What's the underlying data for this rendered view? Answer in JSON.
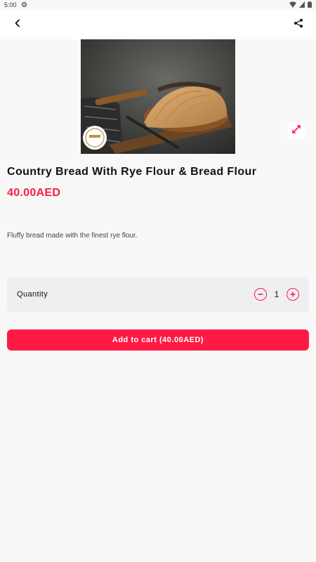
{
  "status_bar": {
    "time": "5:00",
    "icons": [
      "settings-icon",
      "wifi-icon",
      "signal-icon",
      "battery-icon"
    ]
  },
  "app_bar": {
    "back_icon": "chevron-left-icon",
    "share_icon": "share-icon"
  },
  "product": {
    "image_alt": "Country bread sliced on board",
    "name": "Country Bread With Rye Flour & Bread Flour",
    "price": "40.00AED",
    "description": "Fluffy bread made with the finest rye flour."
  },
  "quantity": {
    "label": "Quantity",
    "value": "1"
  },
  "cart": {
    "add_label": "Add to cart (40.00AED)"
  },
  "colors": {
    "accent": "#ff1a46",
    "background": "#f8f8f8",
    "card": "#efeff2"
  }
}
